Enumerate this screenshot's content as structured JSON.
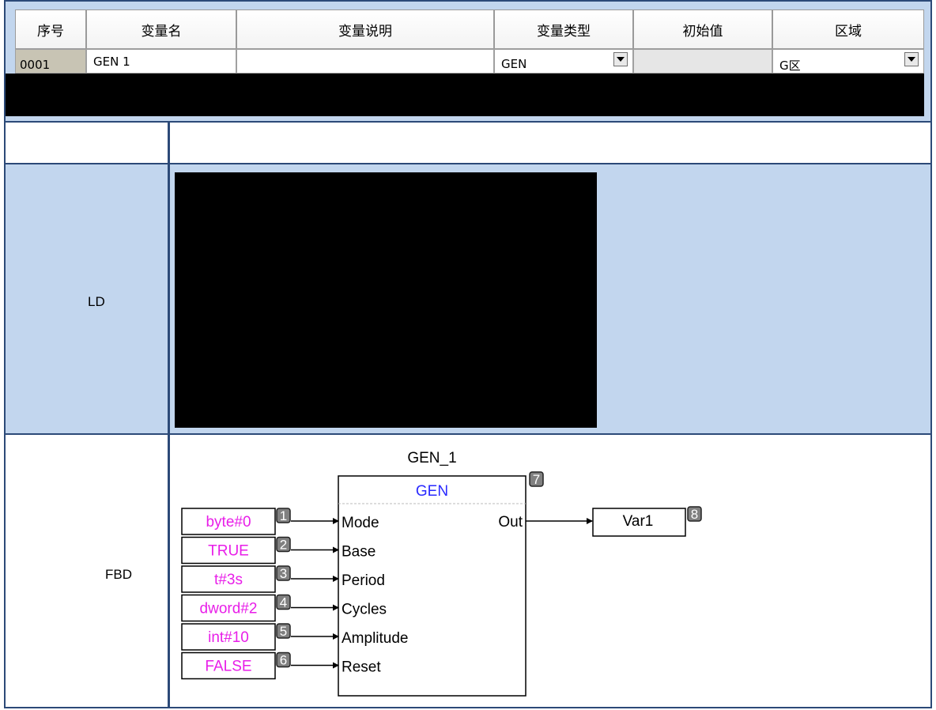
{
  "var_table": {
    "headers": [
      "序号",
      "变量名",
      "变量说明",
      "变量类型",
      "初始值",
      "区域"
    ],
    "row": {
      "index": "0001",
      "name": "GEN 1",
      "description": "",
      "type": "GEN",
      "initial": "",
      "region": "G区"
    }
  },
  "sections": {
    "ld_label": "LD",
    "fbd_label": "FBD"
  },
  "fbd": {
    "instance_name": "GEN_1",
    "block_type": "GEN",
    "block_badge": "7",
    "inputs": [
      {
        "value": "byte#0",
        "badge": "1",
        "pin": "Mode"
      },
      {
        "value": "TRUE",
        "badge": "2",
        "pin": "Base"
      },
      {
        "value": "t#3s",
        "badge": "3",
        "pin": "Period"
      },
      {
        "value": "dword#2",
        "badge": "4",
        "pin": "Cycles"
      },
      {
        "value": "int#10",
        "badge": "5",
        "pin": "Amplitude"
      },
      {
        "value": "FALSE",
        "badge": "6",
        "pin": "Reset"
      }
    ],
    "output": {
      "pin": "Out",
      "var": "Var1",
      "badge": "8"
    }
  },
  "colors": {
    "cell_blue": "#c2d6ee",
    "border": "#2c4a78",
    "constant": "#e81ee8",
    "block_type": "#2a2aff",
    "badge": "#808080"
  }
}
